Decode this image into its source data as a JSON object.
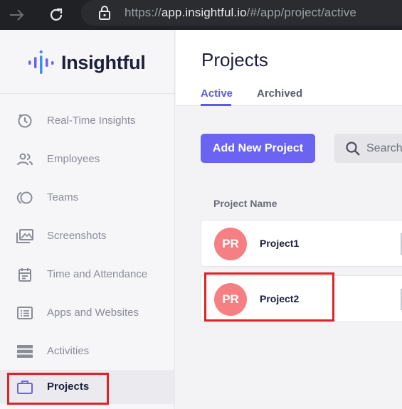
{
  "browser": {
    "url_scheme": "https://",
    "url_host": "app.insightful.io",
    "url_path": "/#/app/project/active"
  },
  "brand": {
    "name": "Insightful",
    "accent_color": "#6b63f1",
    "avatar_color": "#f57f82",
    "highlight_color": "#e32028"
  },
  "sidebar": {
    "items": [
      {
        "label": "Real-Time Insights",
        "icon": "clock-icon"
      },
      {
        "label": "Employees",
        "icon": "people-icon"
      },
      {
        "label": "Teams",
        "icon": "teams-icon"
      },
      {
        "label": "Screenshots",
        "icon": "images-icon"
      },
      {
        "label": "Time and Attendance",
        "icon": "calendar-icon"
      },
      {
        "label": "Apps and Websites",
        "icon": "apps-icon"
      },
      {
        "label": "Activities",
        "icon": "activities-icon"
      },
      {
        "label": "Projects",
        "icon": "briefcase-icon",
        "active": true
      }
    ]
  },
  "main": {
    "title": "Projects",
    "tabs": [
      {
        "label": "Active",
        "active": true
      },
      {
        "label": "Archived",
        "active": false
      }
    ],
    "add_button": "Add New Project",
    "search_placeholder": "Search",
    "column_header": "Project Name",
    "projects": [
      {
        "initials": "PR",
        "name": "Project1"
      },
      {
        "initials": "PR",
        "name": "Project2"
      }
    ]
  }
}
